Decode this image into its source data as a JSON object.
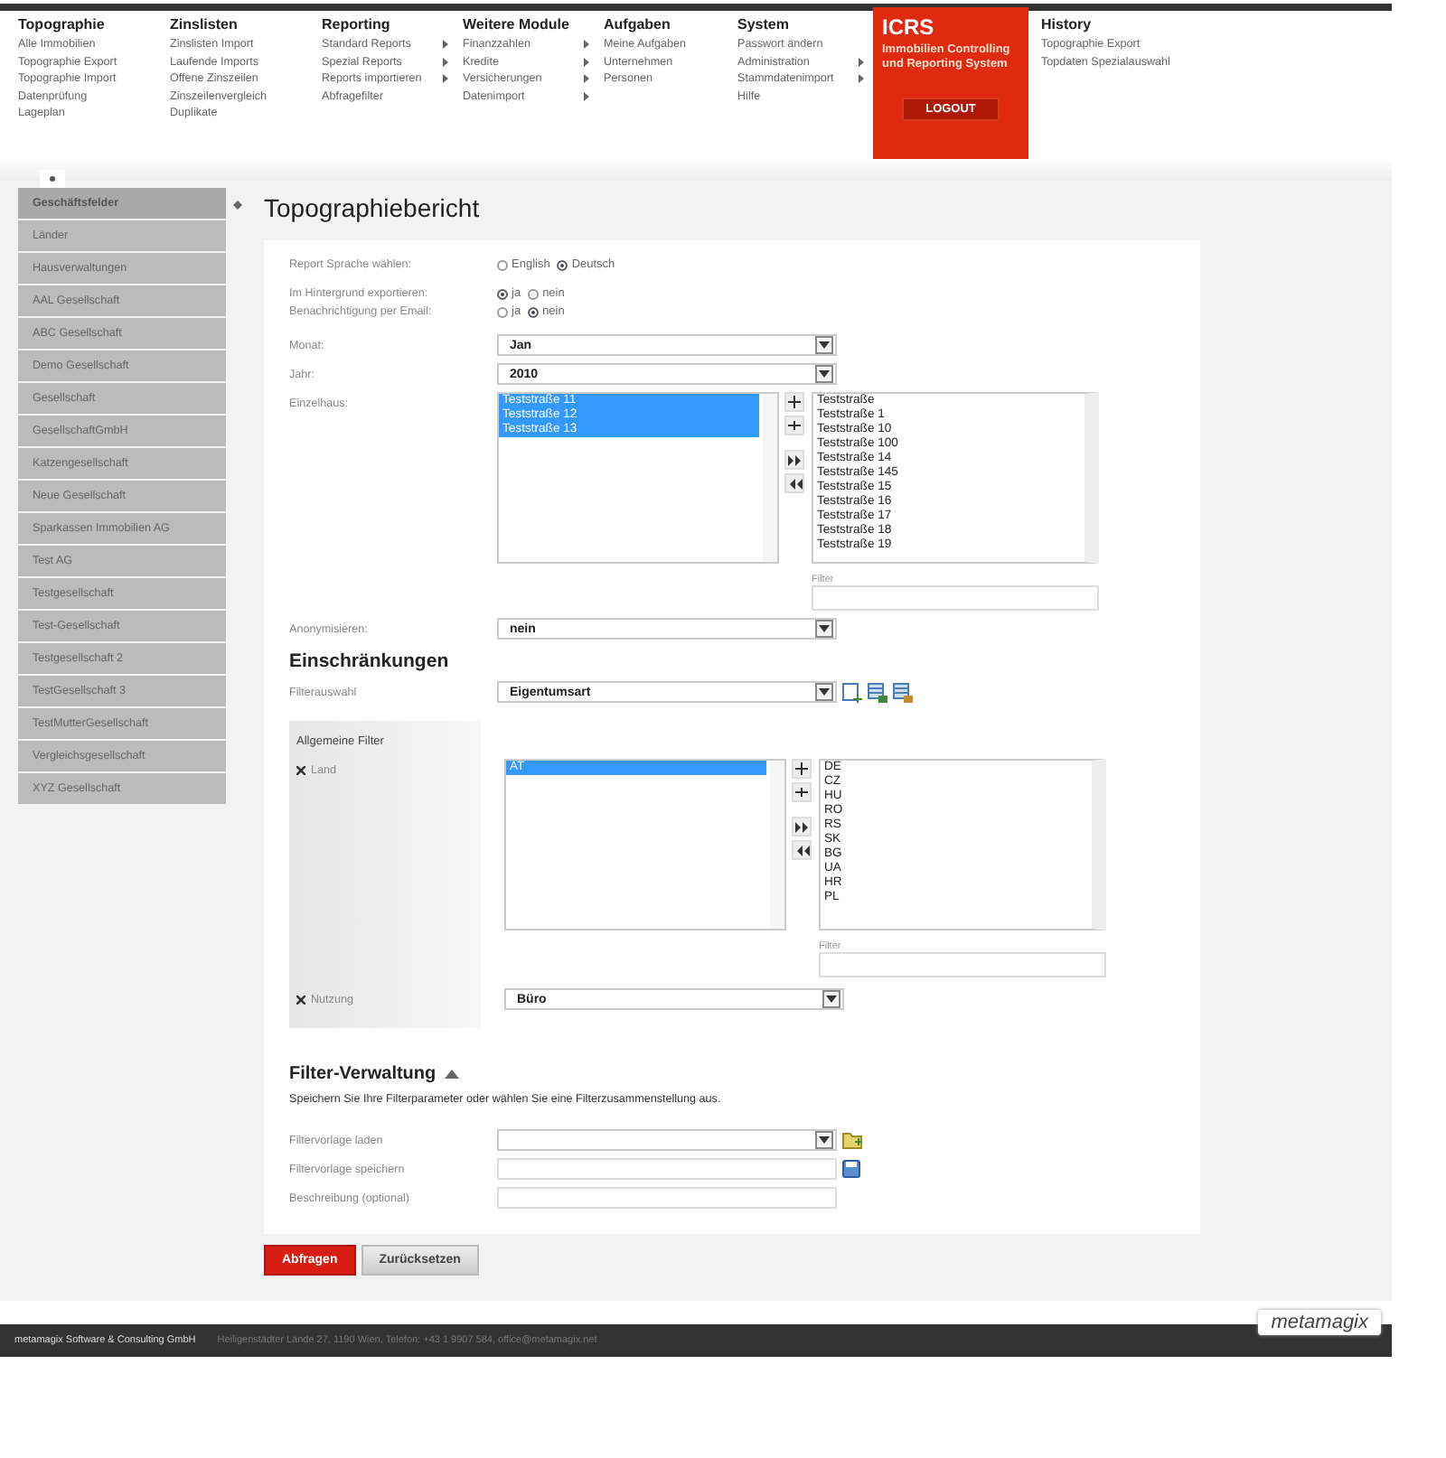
{
  "nav": [
    {
      "title": "Topographie",
      "items": [
        {
          "label": "Alle Immobilien",
          "submenu": false
        },
        {
          "label": "Topographie Export",
          "submenu": false
        },
        {
          "label": "Topographie Import",
          "submenu": false
        },
        {
          "label": "Datenprüfung",
          "submenu": false
        },
        {
          "label": "Lageplan",
          "submenu": false
        }
      ]
    },
    {
      "title": "Zinslisten",
      "items": [
        {
          "label": "Zinslisten Import",
          "submenu": false
        },
        {
          "label": "Laufende Imports",
          "submenu": false
        },
        {
          "label": "Offene Zinszeilen",
          "submenu": false
        },
        {
          "label": "Zinszeilenvergleich",
          "submenu": false
        },
        {
          "label": "Duplikate",
          "submenu": false
        }
      ]
    },
    {
      "title": "Reporting",
      "items": [
        {
          "label": "Standard Reports",
          "submenu": true
        },
        {
          "label": "Spezial Reports",
          "submenu": true
        },
        {
          "label": "Reports importieren",
          "submenu": true
        },
        {
          "label": "Abfragefilter",
          "submenu": false
        }
      ]
    },
    {
      "title": "Weitere Module",
      "items": [
        {
          "label": "Finanzzahlen",
          "submenu": true
        },
        {
          "label": "Kredite",
          "submenu": true
        },
        {
          "label": "Versicherungen",
          "submenu": true
        },
        {
          "label": "Datenimport",
          "submenu": true
        }
      ]
    },
    {
      "title": "Aufgaben",
      "items": [
        {
          "label": "Meine Aufgaben",
          "submenu": false
        },
        {
          "label": "Unternehmen",
          "submenu": false
        },
        {
          "label": "Personen",
          "submenu": false
        }
      ]
    },
    {
      "title": "System",
      "items": [
        {
          "label": "Passwort ändern",
          "submenu": false
        },
        {
          "label": "Administration",
          "submenu": true
        },
        {
          "label": "Stammdatenimport",
          "submenu": true
        },
        {
          "label": "Hilfe",
          "submenu": false
        }
      ]
    }
  ],
  "icrs": {
    "title": "ICRS",
    "subtitle": "Immobilien Controlling und Reporting System",
    "logout": "LOGOUT"
  },
  "history": {
    "title": "History",
    "items": [
      "Topographie Export",
      "Topdaten Spezialauswahl"
    ]
  },
  "sidebar": {
    "items": [
      {
        "label": "Geschäftsfelder",
        "selected": true
      },
      {
        "label": "Länder",
        "selected": false
      },
      {
        "label": "Hausverwaltungen",
        "selected": false
      },
      {
        "label": "AAL Gesellschaft",
        "selected": false
      },
      {
        "label": "ABC Gesellschaft",
        "selected": false
      },
      {
        "label": "Demo Gesellschaft",
        "selected": false
      },
      {
        "label": "Gesellschaft",
        "selected": false
      },
      {
        "label": "GesellschaftGmbH",
        "selected": false
      },
      {
        "label": "Katzengesellschaft",
        "selected": false
      },
      {
        "label": "Neue Gesellschaft",
        "selected": false
      },
      {
        "label": "Sparkassen Immobilien AG",
        "selected": false
      },
      {
        "label": "Test AG",
        "selected": false
      },
      {
        "label": "Testgesellschaft",
        "selected": false
      },
      {
        "label": "Test-Gesellschaft",
        "selected": false
      },
      {
        "label": "Testgesellschaft 2",
        "selected": false
      },
      {
        "label": "TestGesellschaft 3",
        "selected": false
      },
      {
        "label": "TestMutterGesellschaft",
        "selected": false
      },
      {
        "label": "Vergleichsgesellschaft",
        "selected": false
      },
      {
        "label": "XYZ Gesellschaft",
        "selected": false
      }
    ]
  },
  "page_title": "Topographiebericht",
  "form": [
    {
      "kind": "radio",
      "label": "Report Sprache wählen:",
      "options": [
        {
          "label": "English",
          "selected": false
        },
        {
          "label": "Deutsch",
          "selected": true
        }
      ]
    },
    {
      "kind": "radio",
      "label": "Im Hintergrund exportieren:",
      "options": [
        {
          "label": "ja",
          "selected": true
        },
        {
          "label": "nein",
          "selected": false
        }
      ]
    },
    {
      "kind": "radio",
      "label": "Benachrichtigung per Email:",
      "options": [
        {
          "label": "ja",
          "selected": false
        },
        {
          "label": "nein",
          "selected": true
        }
      ]
    },
    {
      "kind": "select",
      "label": "Monat:",
      "value": "Jan"
    },
    {
      "kind": "select",
      "label": "Jahr:",
      "value": "2010"
    },
    {
      "kind": "duallist",
      "label": "Einzelhaus:",
      "chosen": [
        {
          "label": "Teststraße 11",
          "selected": true
        },
        {
          "label": "Teststraße 12",
          "selected": true
        },
        {
          "label": "Teststraße 13",
          "selected": true
        }
      ],
      "available": [
        "Teststraße",
        "Teststraße 1",
        "Teststraße 10",
        "Teststraße 100",
        "Teststraße 14",
        "Teststraße 145",
        "Teststraße 15",
        "Teststraße 16",
        "Teststraße 17",
        "Teststraße 18",
        "Teststraße 19"
      ],
      "filter_label": "Filter"
    },
    {
      "kind": "select",
      "label": "Anonymisieren:",
      "value": "nein"
    }
  ],
  "restrictions": {
    "heading": "Einschränkungen",
    "filter_select": {
      "label": "Filterauswahl",
      "value": "Eigentumsart"
    },
    "box_title": "Allgemeine Filter",
    "filters": [
      {
        "kind": "duallist",
        "label": "Land",
        "chosen": [
          {
            "label": "AT",
            "selected": true
          }
        ],
        "available": [
          "DE",
          "CZ",
          "HU",
          "RO",
          "RS",
          "SK",
          "BG",
          "UA",
          "HR",
          "PL"
        ],
        "filter_label": "Filter"
      },
      {
        "kind": "select",
        "label": "Nutzung",
        "value": "Büro"
      }
    ]
  },
  "filter_management": {
    "heading": "Filter-Verwaltung",
    "description": "Speichern Sie Ihre Filterparameter oder wählen Sie eine Filterzusammenstellung aus.",
    "rows": [
      {
        "kind": "load",
        "label": "Filtervorlage laden"
      },
      {
        "kind": "save",
        "label": "Filtervorlage speichern"
      },
      {
        "kind": "text",
        "label": "Beschreibung (optional)"
      }
    ]
  },
  "buttons": [
    {
      "label": "Abfragen",
      "kind": "primary"
    },
    {
      "label": "Zurücksetzen",
      "kind": "secondary"
    }
  ],
  "footer": {
    "company": "metamagix Software & Consulting GmbH",
    "address": "Heiligenstädter Lände 27, 1190 Wien, Telefon: +43 1 9907 584, office@metamagix.net",
    "logo": "metamagix"
  }
}
